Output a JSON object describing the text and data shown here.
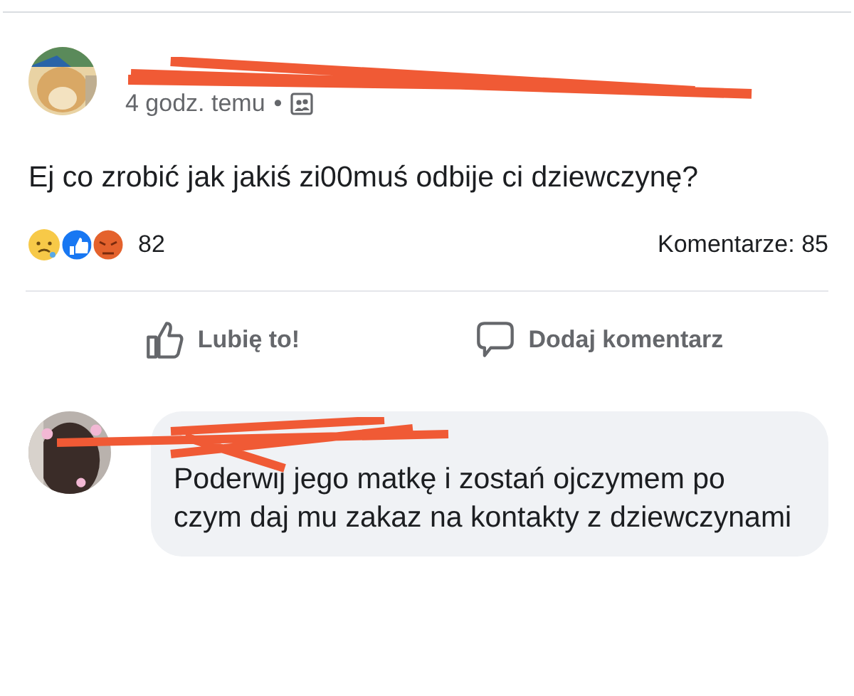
{
  "post": {
    "time": "4 godz. temu",
    "separator": "•",
    "text": "Ej co zrobić jak jakiś zi00muś odbije ci dziewczynę?",
    "reaction_count": "82",
    "comments_count": "Komentarze: 85"
  },
  "actions": [
    {
      "kind": "like",
      "label": "Lubię to!"
    },
    {
      "kind": "comment",
      "label": "Dodaj komentarz"
    }
  ],
  "comment": {
    "text": "Poderwij jego matkę i zostań ojczymem po czym daj mu zakaz na kontakty z dziewczynami"
  }
}
